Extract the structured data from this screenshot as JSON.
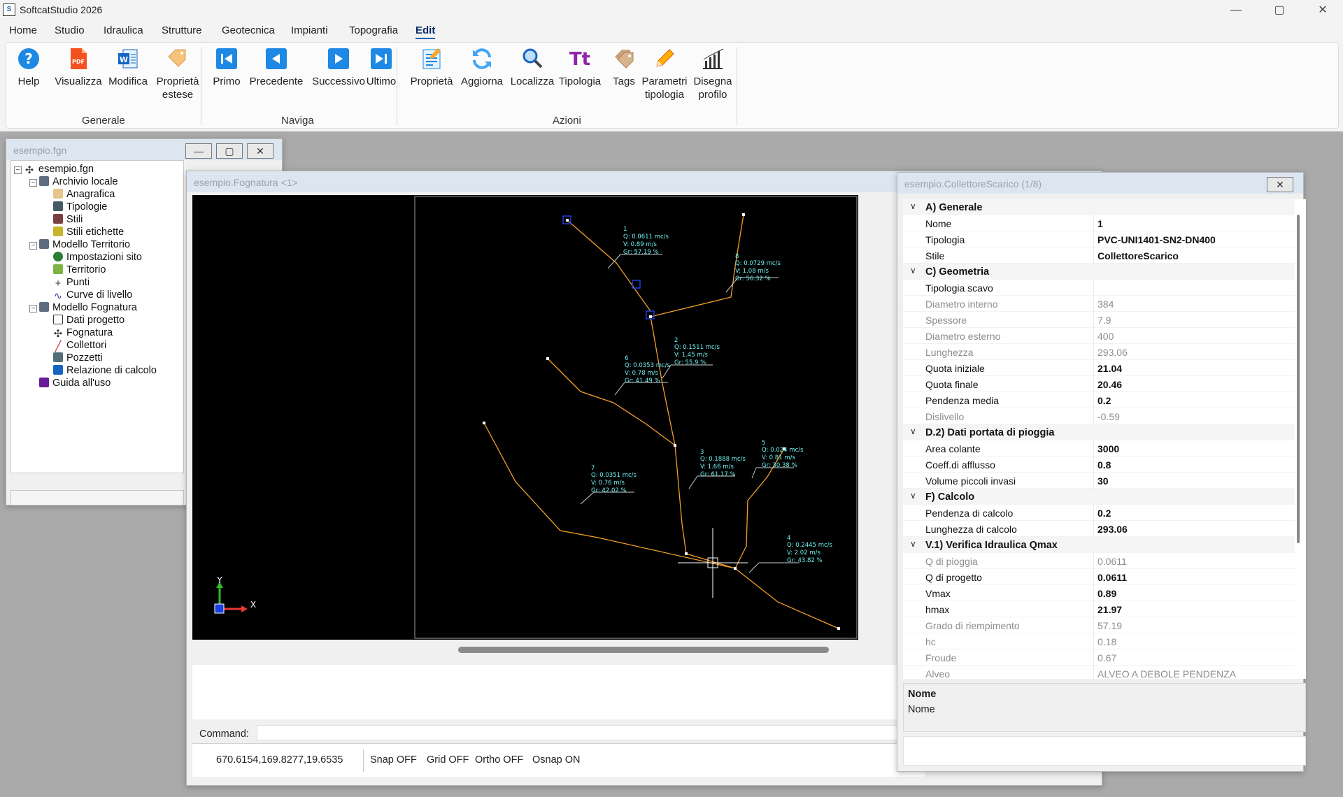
{
  "app": {
    "title": "SoftcatStudio 2026",
    "icon": "app-logo-icon"
  },
  "window_controls": {
    "minimize": "—",
    "maximize": "▢",
    "close": "✕"
  },
  "menu": [
    "Home",
    "Studio",
    "Idraulica",
    "Strutture",
    "Geotecnica",
    "Impianti",
    "Topografia",
    "Edit"
  ],
  "menu_active": "Edit",
  "ribbon": {
    "groups": [
      "Generale",
      "Naviga",
      "Azioni"
    ],
    "buttons": {
      "help": "Help",
      "visualizza": "Visualizza",
      "modifica": "Modifica",
      "proprieta_estese_1": "Proprietà",
      "proprieta_estese_2": "estese",
      "primo": "Primo",
      "precedente": "Precedente",
      "successivo": "Successivo",
      "ultimo": "Ultimo",
      "proprieta": "Proprietà",
      "aggiorna": "Aggiorna",
      "localizza": "Localizza",
      "tipologia": "Tipologia",
      "tipologia_glyph": "Tt",
      "tags": "Tags",
      "parametri_1": "Parametri",
      "parametri_2": "tipologia",
      "disegna_1": "Disegna",
      "disegna_2": "profilo"
    }
  },
  "project_window": {
    "title": "esempio.fgn",
    "tree": {
      "root": "esempio.fgn",
      "archivio": "Archivio locale",
      "anagrafica": "Anagrafica",
      "tipologie": "Tipologie",
      "stili": "Stili",
      "stili_etichette": "Stili etichette",
      "modello_territorio": "Modello Territorio",
      "impostazioni_sito": "Impostazioni sito",
      "territorio": "Territorio",
      "punti": "Punti",
      "curve_livello": "Curve di livello",
      "modello_fognatura": "Modello Fognatura",
      "dati_progetto": "Dati progetto",
      "fognatura": "Fognatura",
      "collettori": "Collettori",
      "pozzetti": "Pozzetti",
      "relazione": "Relazione di calcolo",
      "guida": "Guida all'uso"
    }
  },
  "drawing_window": {
    "title": "esempio.Fognatura <1>",
    "axis_y": "Y",
    "axis_x": "X",
    "labels": [
      {
        "id": "1",
        "q": "Q: 0.0611 mc/s",
        "v": "V: 0.89 m/s",
        "gr": "Gr: 57.19 %"
      },
      {
        "id": "8",
        "q": "Q: 0.0729 mc/s",
        "v": "V: 1.08 m/s",
        "gr": "Gr: 56.32 %"
      },
      {
        "id": "2",
        "q": "Q: 0.1511 mc/s",
        "v": "V: 1.45 m/s",
        "gr": "Gr: 55.9 %"
      },
      {
        "id": "6",
        "q": "Q: 0.0353 mc/s",
        "v": "V: 0.78 m/s",
        "gr": "Gr: 41.49 %"
      },
      {
        "id": "3",
        "q": "Q: 0.1888 mc/s",
        "v": "V: 1.66 m/s",
        "gr": "Gr: 61.17 %"
      },
      {
        "id": "5",
        "q": "Q: 0.024 mc/s",
        "v": "V: 0.81 m/s",
        "gr": "Gr: 30.38 %"
      },
      {
        "id": "7",
        "q": "Q: 0.0351 mc/s",
        "v": "V: 0.76 m/s",
        "gr": "Gr: 42.02 %"
      },
      {
        "id": "4",
        "q": "Q: 0.2445 mc/s",
        "v": "V: 2.02 m/s",
        "gr": "Gr: 43.82 %"
      }
    ],
    "command_label": "Command:",
    "coordinates": "670.6154,169.8277,19.6535",
    "snap": "Snap OFF",
    "grid": "Grid OFF",
    "ortho": "Ortho OFF",
    "osnap": "Osnap ON"
  },
  "properties_window": {
    "title": "esempio.CollettoreScarico (1/8)",
    "categories": {
      "generale": "A) Generale",
      "geometria": "C) Geometria",
      "pioggia": "D.2) Dati portata di pioggia",
      "calcolo": "F) Calcolo",
      "verifica": "V.1) Verifica Idraulica Qmax"
    },
    "rows": {
      "nome": {
        "name": "Nome",
        "value": "1"
      },
      "tipologia": {
        "name": "Tipologia",
        "value": "PVC-UNI1401-SN2-DN400"
      },
      "stile": {
        "name": "Stile",
        "value": "CollettoreScarico"
      },
      "tipologia_scavo": {
        "name": "Tipologia scavo",
        "value": ""
      },
      "diametro_interno": {
        "name": "Diametro interno",
        "value": "384"
      },
      "spessore": {
        "name": "Spessore",
        "value": "7.9"
      },
      "diametro_esterno": {
        "name": "Diametro esterno",
        "value": "400"
      },
      "lunghezza": {
        "name": "Lunghezza",
        "value": "293.06"
      },
      "quota_iniziale": {
        "name": "Quota iniziale",
        "value": "21.04"
      },
      "quota_finale": {
        "name": "Quota finale",
        "value": "20.46"
      },
      "pendenza_media": {
        "name": "Pendenza media",
        "value": "0.2"
      },
      "dislivello": {
        "name": "Dislivello",
        "value": "-0.59"
      },
      "area_colante": {
        "name": "Area colante",
        "value": "3000"
      },
      "coeff_afflusso": {
        "name": "Coeff.di afflusso",
        "value": "0.8"
      },
      "volume_invasi": {
        "name": "Volume piccoli invasi",
        "value": "30"
      },
      "pendenza_calcolo": {
        "name": "Pendenza di calcolo",
        "value": "0.2"
      },
      "lunghezza_calcolo": {
        "name": "Lunghezza di calcolo",
        "value": "293.06"
      },
      "q_pioggia": {
        "name": "Q di pioggia",
        "value": "0.0611"
      },
      "q_progetto": {
        "name": "Q di progetto",
        "value": "0.0611"
      },
      "vmax": {
        "name": "Vmax",
        "value": "0.89"
      },
      "hmax": {
        "name": "hmax",
        "value": "21.97"
      },
      "grado_riempimento": {
        "name": "Grado di riempimento",
        "value": "57.19"
      },
      "hc": {
        "name": "hc",
        "value": "0.18"
      },
      "froude": {
        "name": "Froude",
        "value": "0.67"
      },
      "alveo": {
        "name": "Alveo",
        "value": "ALVEO A DEBOLE PENDENZA"
      }
    },
    "description": {
      "title": "Nome",
      "text": "Nome"
    }
  }
}
